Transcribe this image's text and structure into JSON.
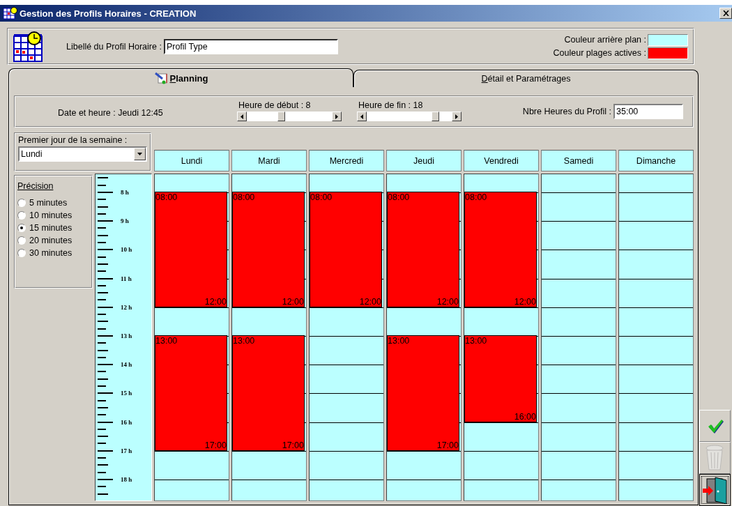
{
  "window": {
    "title": "Gestion des Profils Horaires - CREATION"
  },
  "profile": {
    "label": "Libellé du Profil Horaire :",
    "value": "Profil Type"
  },
  "color_settings": [
    {
      "label": "Couleur arrière plan :",
      "color": "#bbffff"
    },
    {
      "label": "Couleur plages actives :",
      "color": "#ff0000"
    }
  ],
  "tabs": [
    {
      "label": "Planning",
      "selected": true
    },
    {
      "label": "Détail et Paramétrages",
      "selected": false
    }
  ],
  "info": {
    "date_time": "Date et heure : Jeudi 12:45",
    "start_slider": {
      "label": "Heure de début : 8",
      "level": 0.4
    },
    "end_slider": {
      "label": "Heure de fin : 18",
      "level": 0.8
    },
    "hours": {
      "label": "Nbre Heures du Profil :",
      "value": "35:00"
    }
  },
  "first_day": {
    "label": "Premier jour de la semaine :",
    "value": "Lundi"
  },
  "precision": {
    "title": "Précision",
    "options": [
      {
        "label": "5 minutes",
        "selected": false
      },
      {
        "label": "10 minutes",
        "selected": false
      },
      {
        "label": "15 minutes",
        "selected": true
      },
      {
        "label": "20 minutes",
        "selected": false
      },
      {
        "label": "30 minutes",
        "selected": false
      }
    ]
  },
  "ruler": {
    "labels": [
      "8 h",
      "9 h",
      "10 h",
      "11 h",
      "12 h",
      "13 h",
      "14 h",
      "15 h",
      "16 h",
      "17 h",
      "18 h"
    ]
  },
  "days": [
    {
      "name": "Lundi",
      "slots": [
        {
          "start": "08:00",
          "end": "12:00"
        },
        {
          "start": "13:00",
          "end": "17:00"
        }
      ]
    },
    {
      "name": "Mardi",
      "slots": [
        {
          "start": "08:00",
          "end": "12:00"
        },
        {
          "start": "13:00",
          "end": "17:00"
        }
      ]
    },
    {
      "name": "Mercredi",
      "slots": [
        {
          "start": "08:00",
          "end": "12:00"
        }
      ]
    },
    {
      "name": "Jeudi",
      "slots": [
        {
          "start": "08:00",
          "end": "12:00"
        },
        {
          "start": "13:00",
          "end": "17:00"
        }
      ]
    },
    {
      "name": "Vendredi",
      "slots": [
        {
          "start": "08:00",
          "end": "12:00"
        },
        {
          "start": "13:00",
          "end": "16:00"
        }
      ]
    },
    {
      "name": "Samedi"
    },
    {
      "name": "Dimanche"
    }
  ],
  "actions": [
    {
      "kind": "validate",
      "disabled": false
    },
    {
      "kind": "delete",
      "disabled": true
    },
    {
      "kind": "exit",
      "disabled": false
    }
  ]
}
